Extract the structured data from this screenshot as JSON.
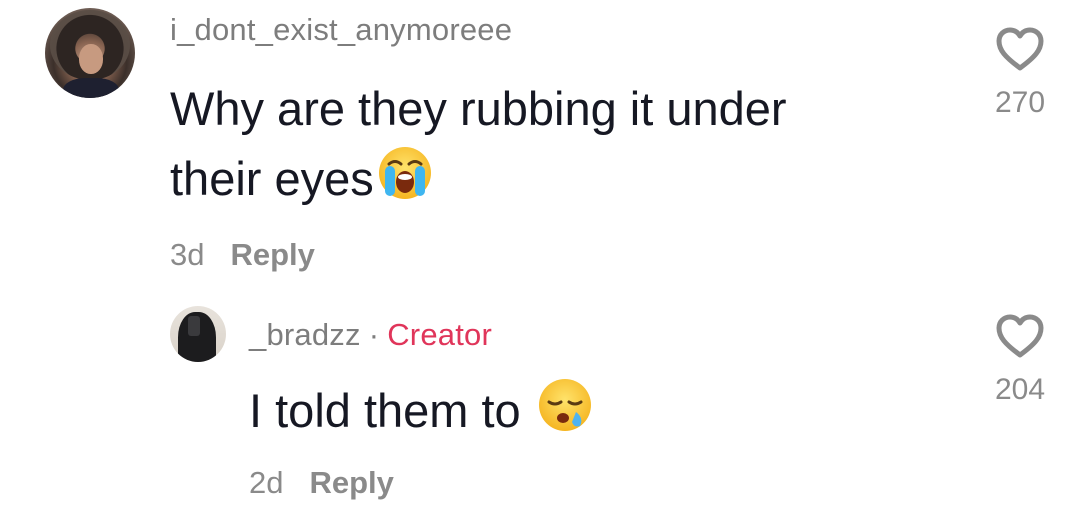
{
  "comments": [
    {
      "username": "i_dont_exist_anymoreee",
      "text_line1": "Why are they rubbing it under",
      "text_line2": "their eyes",
      "emoji": "loudly-crying-face",
      "time": "3d",
      "reply_label": "Reply",
      "likes": "270"
    }
  ],
  "reply": {
    "username": "_bradzz",
    "separator": "·",
    "badge": "Creator",
    "text": "I told them to",
    "emoji": "sleepy-face",
    "time": "2d",
    "reply_label": "Reply",
    "likes": "204"
  },
  "colors": {
    "username": "#7d7d7d",
    "text": "#161823",
    "meta": "#8a8a8a",
    "creator_badge": "#e0355a",
    "heart_outline": "#8a8a8a"
  }
}
